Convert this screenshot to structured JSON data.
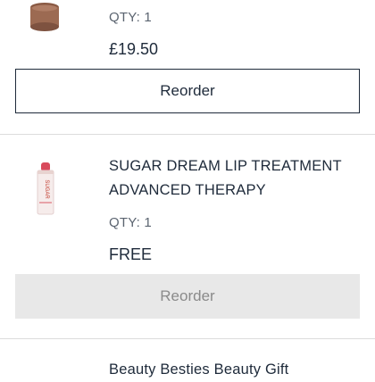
{
  "orders": [
    {
      "qty_text": "QTY: 1",
      "price": "£19.50",
      "reorder_label": "Reorder",
      "image_icon": "lip-scrub-jar-icon"
    },
    {
      "title_line1": "SUGAR DREAM LIP TREATMENT",
      "title_line2": "ADVANCED THERAPY",
      "qty_text": "QTY: 1",
      "price": "FREE",
      "reorder_label": "Reorder",
      "image_icon": "lip-balm-stick-icon",
      "image_brand_text": "SUGAR"
    },
    {
      "title_line1": "Beauty Besties Beauty Gift"
    }
  ],
  "colors": {
    "text": "#1e2a3a",
    "muted": "#5b6470",
    "disabled_bg": "#e8e8e8",
    "disabled_text": "#8a8a8a",
    "divider": "#dcdcdc"
  }
}
